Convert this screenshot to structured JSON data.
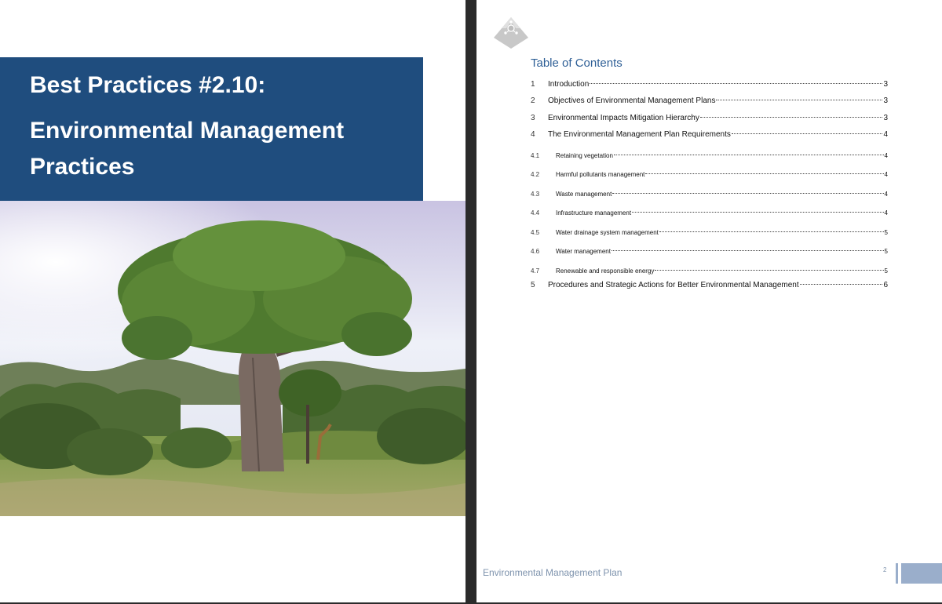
{
  "cover": {
    "title_line1": "Best Practices #2.10:",
    "title_line2": "Environmental Management Practices",
    "colors": {
      "title_band": "#1f4d7e",
      "title_text": "#ffffff"
    }
  },
  "toc": {
    "heading": "Table of Contents",
    "entries": [
      {
        "num": "1",
        "label": "Introduction",
        "page": "3",
        "level": 1
      },
      {
        "num": "2",
        "label": "Objectives of Environmental Management Plans",
        "page": "3",
        "level": 1
      },
      {
        "num": "3",
        "label": "Environmental Impacts Mitigation Hierarchy",
        "page": "3",
        "level": 1
      },
      {
        "num": "4",
        "label": "The Environmental Management Plan Requirements",
        "page": "4",
        "level": 1
      },
      {
        "num": "4.1",
        "label": "Retaining vegetation",
        "page": "4",
        "level": 2
      },
      {
        "num": "4.2",
        "label": "Harmful pollutants management",
        "page": "4",
        "level": 2
      },
      {
        "num": "4.3",
        "label": "Waste management",
        "page": "4",
        "level": 2
      },
      {
        "num": "4.4",
        "label": "Infrastructure management",
        "page": "4",
        "level": 2
      },
      {
        "num": "4.5",
        "label": "Water drainage system management",
        "page": "5",
        "level": 2
      },
      {
        "num": "4.6",
        "label": "Water management",
        "page": "5",
        "level": 2
      },
      {
        "num": "4.7",
        "label": "Renewable and responsible energy",
        "page": "5",
        "level": 2
      },
      {
        "num": "5",
        "label": "Procedures and Strategic Actions for Better Environmental Management",
        "page": "6",
        "level": 1
      }
    ]
  },
  "footer": {
    "text": "Environmental Management Plan",
    "page_number": "2"
  },
  "colors": {
    "heading": "#2e5f96",
    "footer": "#7e93ad"
  },
  "icons": {
    "logo": "puzzle-network-logo-icon"
  }
}
